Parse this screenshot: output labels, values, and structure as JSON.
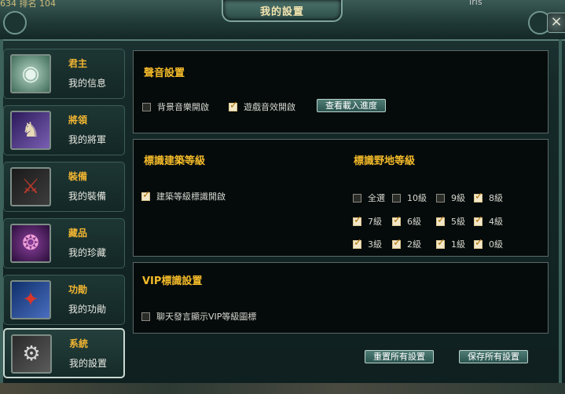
{
  "header": {
    "stats_text": "634   排名 104",
    "title": "我的設置",
    "close_glyph": "×",
    "top_right_text": "Iris"
  },
  "nav": {
    "items": [
      {
        "title": "君主",
        "sub": "我的信息",
        "icon": "lord-jade-icon"
      },
      {
        "title": "將領",
        "sub": "我的將軍",
        "icon": "general-horse-icon"
      },
      {
        "title": "裝備",
        "sub": "我的裝備",
        "icon": "equipment-sword-icon"
      },
      {
        "title": "藏品",
        "sub": "我的珍藏",
        "icon": "collection-beads-icon"
      },
      {
        "title": "功勛",
        "sub": "我的功勛",
        "icon": "merit-blade-icon"
      },
      {
        "title": "系統",
        "sub": "我的設置",
        "icon": "system-gears-icon"
      }
    ],
    "active_index": 5
  },
  "sound": {
    "title": "聲音設置",
    "bgm_label": "背景音樂開啟",
    "bgm_checked": false,
    "sfx_label": "遊戲音效開啟",
    "sfx_checked": true,
    "loading_button": "查看載入進度"
  },
  "labels": {
    "building_title": "標識建築等級",
    "building_checkbox_label": "建築等級標識開啟",
    "building_checked": true,
    "field_title": "標識野地等級",
    "field_levels": [
      {
        "label": "全選",
        "checked": false
      },
      {
        "label": "10級",
        "checked": false
      },
      {
        "label": "9級",
        "checked": false
      },
      {
        "label": "8級",
        "checked": true
      },
      {
        "label": "7級",
        "checked": true
      },
      {
        "label": "6級",
        "checked": true
      },
      {
        "label": "5級",
        "checked": true
      },
      {
        "label": "4級",
        "checked": true
      },
      {
        "label": "3級",
        "checked": true
      },
      {
        "label": "2級",
        "checked": true
      },
      {
        "label": "1級",
        "checked": true
      },
      {
        "label": "0級",
        "checked": true
      }
    ]
  },
  "vip": {
    "title": "VIP標識設置",
    "chat_label": "聊天發言顯示VIP等級圖標",
    "chat_checked": false
  },
  "footer": {
    "reset_button": "重置所有設置",
    "save_button": "保存所有設置"
  },
  "colors": {
    "accent_gold": "#f5bb2a",
    "frame_teal": "#223b3a",
    "panel_bg": "#050b0b"
  }
}
